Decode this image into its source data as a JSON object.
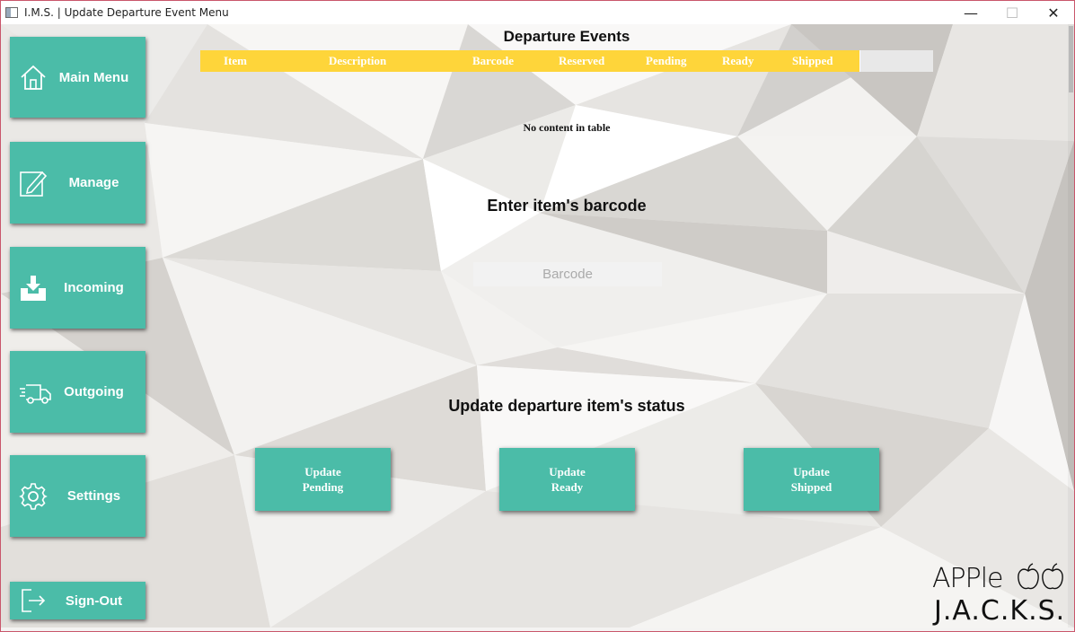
{
  "window": {
    "title": "I.M.S. | Update Departure Event Menu",
    "minimize": "—",
    "maximize": "☐",
    "close": "✕"
  },
  "sidebar": {
    "items": [
      {
        "label": "Main Menu",
        "icon": "home-icon"
      },
      {
        "label": "Manage",
        "icon": "edit-icon"
      },
      {
        "label": "Incoming",
        "icon": "inbox-download-icon"
      },
      {
        "label": "Outgoing",
        "icon": "delivery-truck-icon"
      },
      {
        "label": "Settings",
        "icon": "gear-icon"
      },
      {
        "label": "Sign-Out",
        "icon": "sign-out-icon"
      }
    ]
  },
  "table": {
    "title": "Departure Events",
    "columns": [
      "Item",
      "Description",
      "Barcode",
      "Reserved",
      "Pending",
      "Ready",
      "Shipped"
    ],
    "empty_message": "No content in table",
    "header_color": "#fed53a"
  },
  "barcode_section": {
    "title": "Enter item's barcode",
    "placeholder": "Barcode",
    "value": ""
  },
  "status_section": {
    "title": "Update departure item's status",
    "buttons": [
      {
        "line1": "Update",
        "line2": "Pending"
      },
      {
        "line1": "Update",
        "line2": "Ready"
      },
      {
        "line1": "Update",
        "line2": "Shipped"
      }
    ]
  },
  "logo": {
    "top": "APPle",
    "bottom": "J.A.C.K.S."
  },
  "colors": {
    "accent": "#4bbca8",
    "header": "#fed53a",
    "window_border": "#c9566b"
  }
}
